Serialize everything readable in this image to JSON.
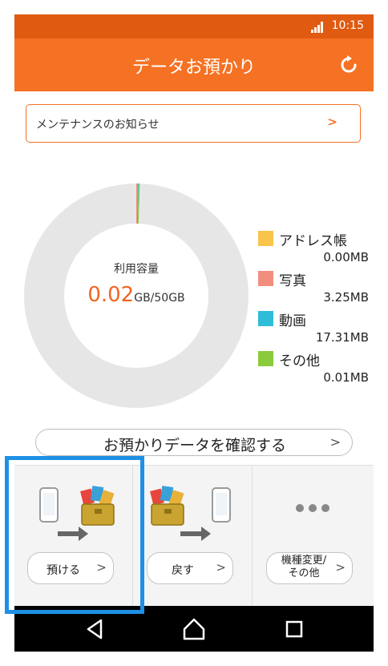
{
  "status_bar": {
    "time": "10:15",
    "signal_icon": "signal-icon"
  },
  "app_bar": {
    "title": "データお預かり",
    "refresh_icon": "refresh-icon"
  },
  "notice": {
    "label": "メンテナンスのお知らせ",
    "chevron": ">"
  },
  "usage": {
    "caption": "利用容量",
    "value": "0.02",
    "unit": "GB/50GB",
    "used_gb": 0.02,
    "total_gb": 50,
    "ring_color": "#e6e6e6"
  },
  "legend": [
    {
      "name": "アドレス帳",
      "value": "0.00MB",
      "mb": 0.0,
      "color": "#f9c44b"
    },
    {
      "name": "写真",
      "value": "3.25MB",
      "mb": 3.25,
      "color": "#f28e7f"
    },
    {
      "name": "動画",
      "value": "17.31MB",
      "mb": 17.31,
      "color": "#2fbcd9"
    },
    {
      "name": "その他",
      "value": "0.01MB",
      "mb": 0.01,
      "color": "#8acb3c"
    }
  ],
  "confirm_button": {
    "label": "お預かりデータを確認する",
    "chevron": ">"
  },
  "actions": [
    {
      "label": "預ける",
      "chevron": ">",
      "icon": "phone-to-toolbox-icon"
    },
    {
      "label": "戻す",
      "chevron": ">",
      "icon": "toolbox-to-phone-icon"
    },
    {
      "label": "機種変更/\nその他",
      "chevron": ">",
      "icon": "more-dots-icon"
    }
  ],
  "navigation": {
    "back_icon": "back-icon",
    "home_icon": "home-icon",
    "recents_icon": "recents-icon"
  },
  "colors": {
    "accent": "#f57123",
    "status_bar": "#e05a12",
    "highlight": "#1e90e6",
    "value_text": "#f26522"
  }
}
